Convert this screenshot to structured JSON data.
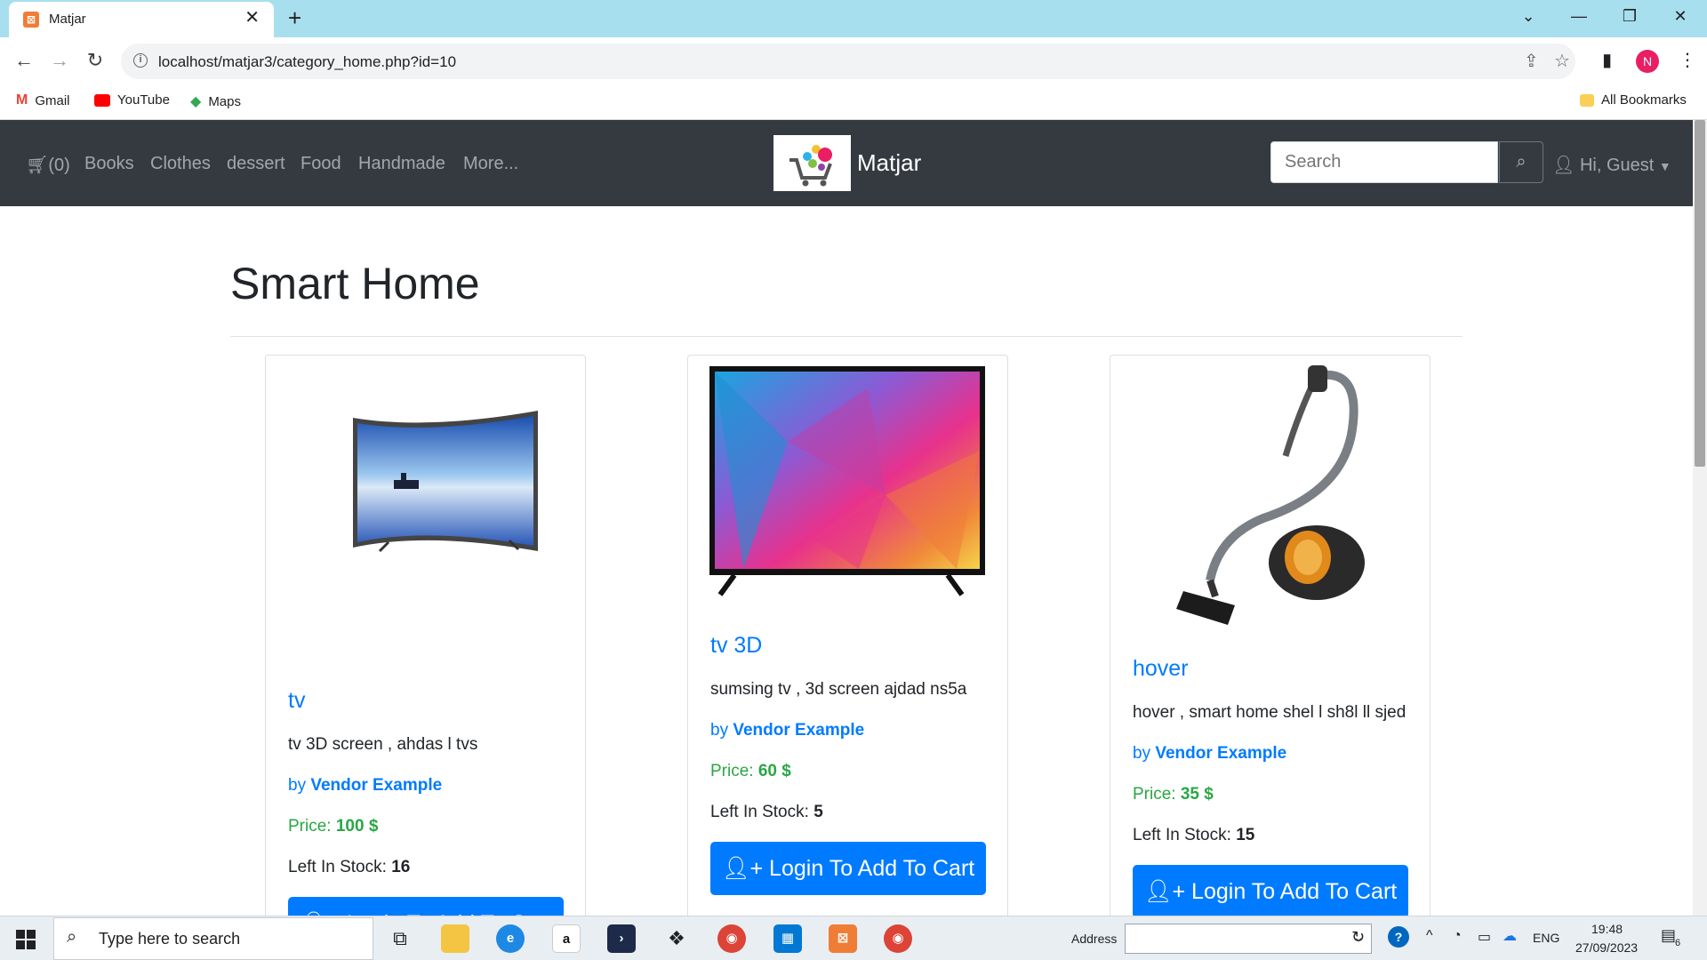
{
  "browser": {
    "tab_title": "Matjar",
    "url": "localhost/matjar3/category_home.php?id=10",
    "bookmarks": [
      "Gmail",
      "YouTube",
      "Maps"
    ],
    "all_bookmarks": "All Bookmarks",
    "profile_initial": "N"
  },
  "nav": {
    "cart_count": "(0)",
    "links": [
      "Books",
      "Clothes",
      "dessert",
      "Food",
      "Handmade",
      "More..."
    ],
    "brand": "Matjar",
    "search_placeholder": "Search",
    "user_greeting": "Hi, Guest"
  },
  "page": {
    "title": "Smart Home"
  },
  "products": [
    {
      "name": "tv",
      "description": "tv 3D screen , ahdas l tvs",
      "by_prefix": "by",
      "vendor": "Vendor Example",
      "price_label": "Price:",
      "price": "100 $",
      "stock_label": "Left In Stock:",
      "stock": "16",
      "button": "Login To Add To Cart"
    },
    {
      "name": "tv 3D",
      "description": "sumsing tv , 3d screen ajdad ns5a",
      "by_prefix": "by",
      "vendor": "Vendor Example",
      "price_label": "Price:",
      "price": "60 $",
      "stock_label": "Left In Stock:",
      "stock": "5",
      "button": "Login To Add To Cart"
    },
    {
      "name": "hover",
      "description": "hover , smart home shel l sh8l ll sjed",
      "by_prefix": "by",
      "vendor": "Vendor Example",
      "price_label": "Price:",
      "price": "35 $",
      "stock_label": "Left In Stock:",
      "stock": "15",
      "button": "Login To Add To Cart"
    }
  ],
  "taskbar": {
    "search_placeholder": "Type here to search",
    "address_label": "Address",
    "language": "ENG",
    "time": "19:48",
    "date": "27/09/2023",
    "notification_count": "6"
  },
  "colors": {
    "navbar": "#343a40",
    "primary": "#007bff",
    "success": "#28a745",
    "tabstrip": "#a8dfee"
  }
}
